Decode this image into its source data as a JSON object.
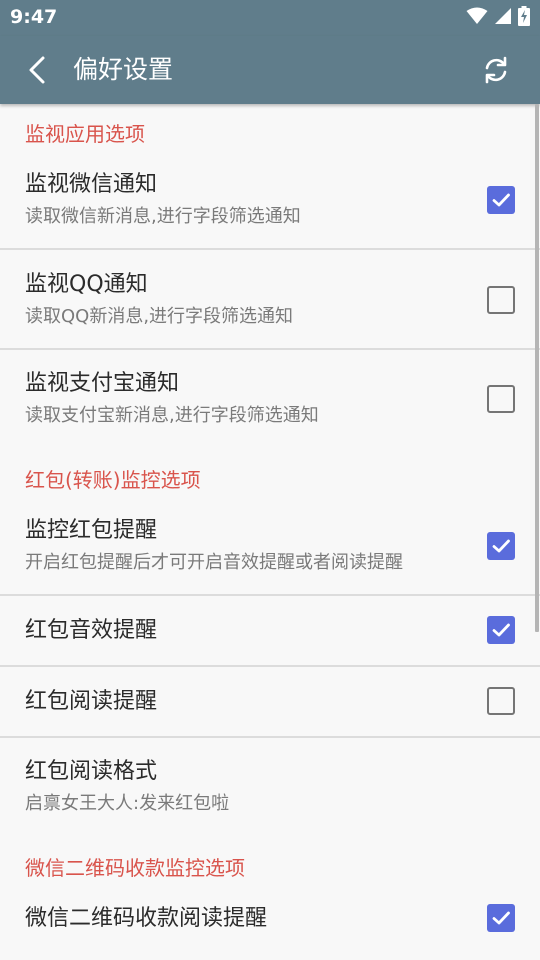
{
  "status_bar": {
    "time": "9:47",
    "icons": [
      "wifi-icon",
      "cell-signal-icon",
      "battery-charging-icon"
    ]
  },
  "app_bar": {
    "title": "偏好设置",
    "back_icon": "back-arrow-icon",
    "refresh_icon": "refresh-icon",
    "color": "#607d8b"
  },
  "colors": {
    "category": "#d9544c",
    "checkbox_checked": "#5a6cdc",
    "checkbox_unchecked": "#757575"
  },
  "sections": [
    {
      "title": "监视应用选项",
      "items": [
        {
          "title": "监视微信通知",
          "summary": "读取微信新消息,进行字段筛选通知",
          "checked": true
        },
        {
          "title": "监视QQ通知",
          "summary": "读取QQ新消息,进行字段筛选通知",
          "checked": false
        },
        {
          "title": "监视支付宝通知",
          "summary": "读取支付宝新消息,进行字段筛选通知",
          "checked": false
        }
      ]
    },
    {
      "title": "红包(转账)监控选项",
      "items": [
        {
          "title": "监控红包提醒",
          "summary": "开启红包提醒后才可开启音效提醒或者阅读提醒",
          "checked": true
        },
        {
          "title": "红包音效提醒",
          "checked": true
        },
        {
          "title": "红包阅读提醒",
          "checked": false
        },
        {
          "title": "红包阅读格式",
          "summary": "启禀女王大人:发来红包啦"
        }
      ]
    },
    {
      "title": "微信二维码收款监控选项",
      "items": [
        {
          "title": "微信二维码收款阅读提醒",
          "checked": true
        }
      ]
    }
  ]
}
